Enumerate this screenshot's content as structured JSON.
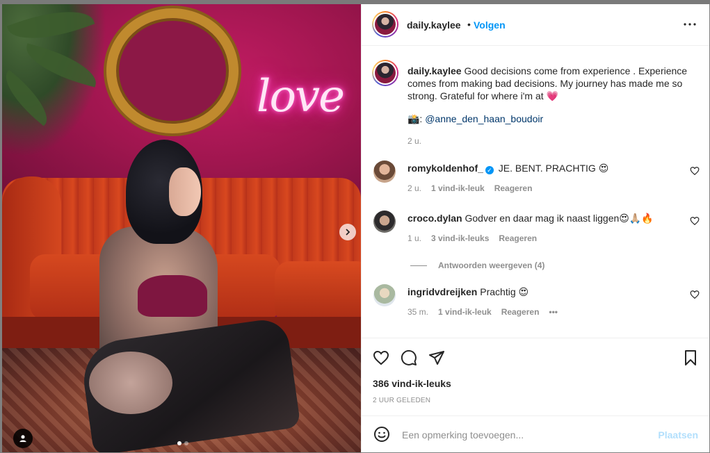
{
  "photo": {
    "neon_text": "love",
    "carousel": {
      "total": 2,
      "active": 1
    }
  },
  "post_header": {
    "username": "daily.kaylee",
    "separator": "•",
    "follow_label": "Volgen"
  },
  "caption": {
    "username": "daily.kaylee",
    "text": "Good decisions come from experience . Experience comes from making bad decisions. My journey has made me so strong. Grateful for where i'm at 💗",
    "credit_prefix": "📸:",
    "credit_mention": "@anne_den_haan_boudoir",
    "time": "2 u."
  },
  "comments": [
    {
      "username": "romykoldenhof_",
      "verified": true,
      "text": "JE. BENT. PRACHTIG 😍",
      "time": "2 u.",
      "likes": "1 vind-ik-leuk",
      "reply": "Reageren"
    },
    {
      "username": "croco.dylan",
      "verified": false,
      "text": "Godver en daar mag ik naast liggen😍🙏🏼🔥",
      "time": "1 u.",
      "likes": "3 vind-ik-leuks",
      "reply": "Reageren"
    },
    {
      "username": "ingridvdreijken",
      "verified": false,
      "text": "Prachtig 😍",
      "time": "35 m.",
      "likes": "1 vind-ik-leuk",
      "reply": "Reageren",
      "more": "•••"
    }
  ],
  "replies_toggle": "Antwoorden weergeven (4)",
  "stats": {
    "likes": "386 vind-ik-leuks",
    "posted": "2 UUR GELEDEN"
  },
  "add_comment": {
    "placeholder": "Een opmerking toevoegen...",
    "post_label": "Plaatsen"
  },
  "colors": {
    "accent": "#0095f6",
    "post_disabled": "#b2dffc",
    "mention": "#00376b",
    "muted": "#8e8e8e"
  }
}
